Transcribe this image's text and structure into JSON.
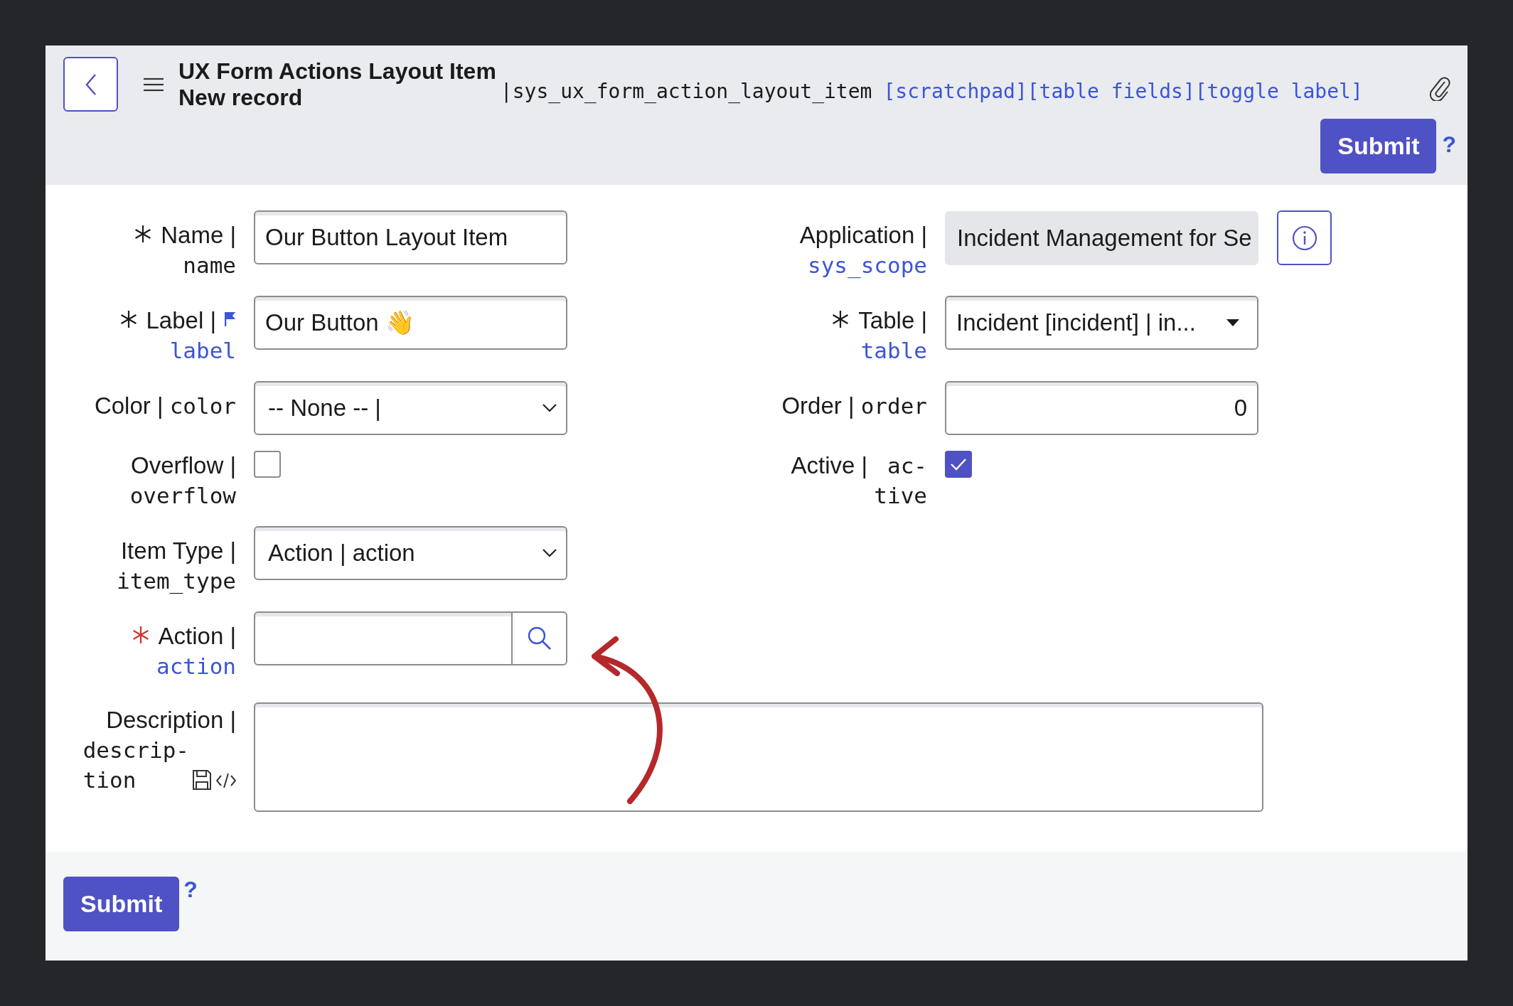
{
  "header": {
    "title": "UX Form Actions Layout Item",
    "subtitle": "New record",
    "table_name": "|sys_ux_form_action_layout_item",
    "links": [
      "[scratchpad]",
      "[table fields]",
      "[toggle label]"
    ],
    "submit": "Submit",
    "help": "?"
  },
  "left_fields": [
    {
      "kind": "text",
      "required": true,
      "missing": false,
      "label": "Name |",
      "field_name": "name",
      "linked": false,
      "flag": false,
      "value": "Our Button Layout Item"
    },
    {
      "kind": "text",
      "required": true,
      "missing": false,
      "label": "Label |",
      "field_name": "label",
      "linked": true,
      "flag": true,
      "value": "Our Button 👋"
    },
    {
      "kind": "select",
      "required": false,
      "missing": false,
      "label": "Color |",
      "field_name": "color",
      "linked": false,
      "flag": false,
      "value": "-- None -- |"
    },
    {
      "kind": "checkbox",
      "required": false,
      "missing": false,
      "label": "Overflow |",
      "field_name": "overflow",
      "linked": false,
      "flag": false,
      "checked": false
    },
    {
      "kind": "select",
      "required": false,
      "missing": false,
      "label": "Item Type |",
      "field_name": "item_type",
      "linked": false,
      "flag": false,
      "value": "Action | action"
    },
    {
      "kind": "reference",
      "required": true,
      "missing": true,
      "label": "Action |",
      "field_name": "action",
      "linked": true,
      "flag": false
    }
  ],
  "right_fields": [
    {
      "kind": "readonly",
      "required": false,
      "missing": false,
      "label": "Application |",
      "field_name": "sys_scope",
      "linked": true,
      "flag": false,
      "value": "Incident Management for Se"
    },
    {
      "kind": "dropdown",
      "required": true,
      "missing": false,
      "label": "Table |",
      "field_name": "table",
      "linked": true,
      "flag": false,
      "value": "Incident [incident] | in..."
    },
    {
      "kind": "number",
      "required": false,
      "missing": false,
      "label": "Order |",
      "field_name": "order",
      "linked": false,
      "flag": false,
      "value": "0"
    },
    {
      "kind": "checkbox",
      "required": false,
      "missing": false,
      "label": "Active |",
      "field_name": "ac-\ntive",
      "linked": false,
      "flag": false,
      "checked": true
    }
  ],
  "description": {
    "label": "Description |",
    "field_name": "descrip-\ntion"
  },
  "footer": {
    "submit": "Submit",
    "help": "?"
  }
}
